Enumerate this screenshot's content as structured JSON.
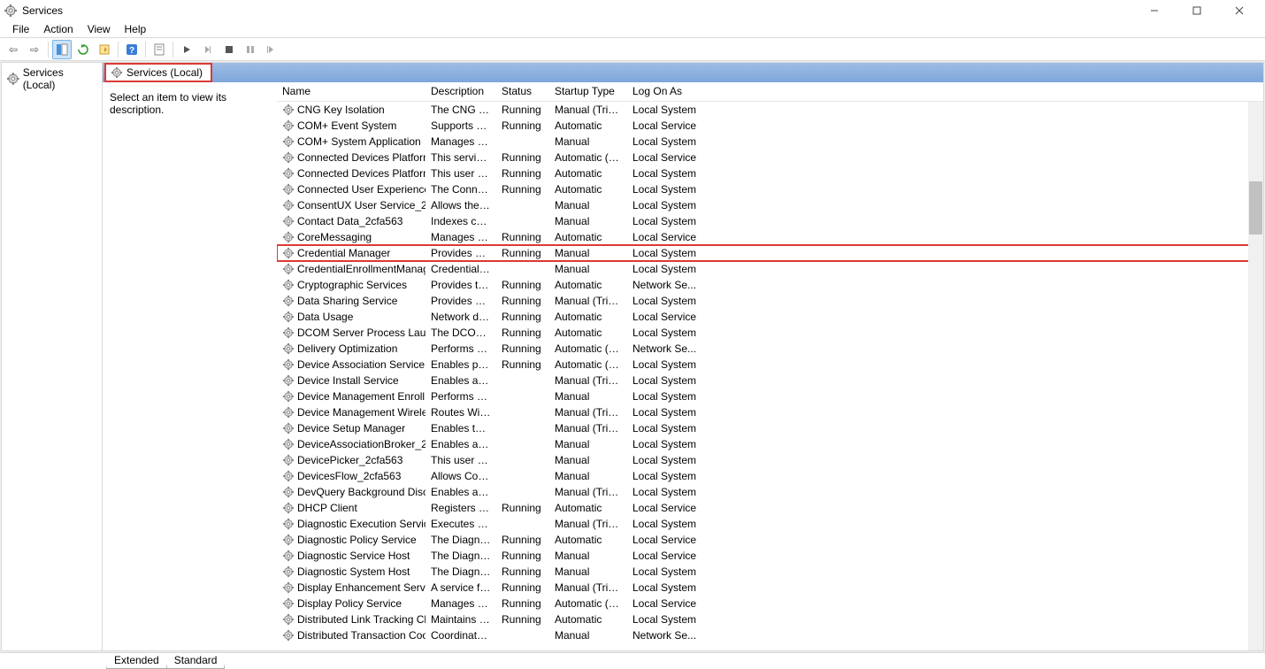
{
  "title": "Services",
  "menus": [
    "File",
    "Action",
    "View",
    "Help"
  ],
  "tree_label": "Services (Local)",
  "tab_label": "Services (Local)",
  "detail_hint": "Select an item to view its description.",
  "columns": [
    "Name",
    "Description",
    "Status",
    "Startup Type",
    "Log On As"
  ],
  "bottom_tabs": [
    "Extended",
    "Standard"
  ],
  "highlight_index": 9,
  "services": [
    {
      "name": "CNG Key Isolation",
      "desc": "The CNG ke...",
      "status": "Running",
      "start": "Manual (Trigg...",
      "logon": "Local System"
    },
    {
      "name": "COM+ Event System",
      "desc": "Supports Sy...",
      "status": "Running",
      "start": "Automatic",
      "logon": "Local Service"
    },
    {
      "name": "COM+ System Application",
      "desc": "Manages th...",
      "status": "",
      "start": "Manual",
      "logon": "Local System"
    },
    {
      "name": "Connected Devices Platform ...",
      "desc": "This service i...",
      "status": "Running",
      "start": "Automatic (De...",
      "logon": "Local Service"
    },
    {
      "name": "Connected Devices Platform ...",
      "desc": "This user ser...",
      "status": "Running",
      "start": "Automatic",
      "logon": "Local System"
    },
    {
      "name": "Connected User Experiences ...",
      "desc": "The Connect...",
      "status": "Running",
      "start": "Automatic",
      "logon": "Local System"
    },
    {
      "name": "ConsentUX User Service_2cf...",
      "desc": "Allows the s...",
      "status": "",
      "start": "Manual",
      "logon": "Local System"
    },
    {
      "name": "Contact Data_2cfa563",
      "desc": "Indexes cont...",
      "status": "",
      "start": "Manual",
      "logon": "Local System"
    },
    {
      "name": "CoreMessaging",
      "desc": "Manages co...",
      "status": "Running",
      "start": "Automatic",
      "logon": "Local Service"
    },
    {
      "name": "Credential Manager",
      "desc": "Provides sec...",
      "status": "Running",
      "start": "Manual",
      "logon": "Local System"
    },
    {
      "name": "CredentialEnrollmentManag...",
      "desc": "Credential E...",
      "status": "",
      "start": "Manual",
      "logon": "Local System"
    },
    {
      "name": "Cryptographic Services",
      "desc": "Provides thr...",
      "status": "Running",
      "start": "Automatic",
      "logon": "Network Se..."
    },
    {
      "name": "Data Sharing Service",
      "desc": "Provides dat...",
      "status": "Running",
      "start": "Manual (Trigg...",
      "logon": "Local System"
    },
    {
      "name": "Data Usage",
      "desc": "Network dat...",
      "status": "Running",
      "start": "Automatic",
      "logon": "Local Service"
    },
    {
      "name": "DCOM Server Process Launc...",
      "desc": "The DCOML...",
      "status": "Running",
      "start": "Automatic",
      "logon": "Local System"
    },
    {
      "name": "Delivery Optimization",
      "desc": "Performs co...",
      "status": "Running",
      "start": "Automatic (De...",
      "logon": "Network Se..."
    },
    {
      "name": "Device Association Service",
      "desc": "Enables pairi...",
      "status": "Running",
      "start": "Automatic (Tri...",
      "logon": "Local System"
    },
    {
      "name": "Device Install Service",
      "desc": "Enables a co...",
      "status": "",
      "start": "Manual (Trigg...",
      "logon": "Local System"
    },
    {
      "name": "Device Management Enroll...",
      "desc": "Performs De...",
      "status": "",
      "start": "Manual",
      "logon": "Local System"
    },
    {
      "name": "Device Management Wireles...",
      "desc": "Routes Wirel...",
      "status": "",
      "start": "Manual (Trigg...",
      "logon": "Local System"
    },
    {
      "name": "Device Setup Manager",
      "desc": "Enables the ...",
      "status": "",
      "start": "Manual (Trigg...",
      "logon": "Local System"
    },
    {
      "name": "DeviceAssociationBroker_2cf...",
      "desc": "Enables app...",
      "status": "",
      "start": "Manual",
      "logon": "Local System"
    },
    {
      "name": "DevicePicker_2cfa563",
      "desc": "This user ser...",
      "status": "",
      "start": "Manual",
      "logon": "Local System"
    },
    {
      "name": "DevicesFlow_2cfa563",
      "desc": "Allows Conn...",
      "status": "",
      "start": "Manual",
      "logon": "Local System"
    },
    {
      "name": "DevQuery Background Disc...",
      "desc": "Enables app...",
      "status": "",
      "start": "Manual (Trigg...",
      "logon": "Local System"
    },
    {
      "name": "DHCP Client",
      "desc": "Registers an...",
      "status": "Running",
      "start": "Automatic",
      "logon": "Local Service"
    },
    {
      "name": "Diagnostic Execution Service",
      "desc": "Executes dia...",
      "status": "",
      "start": "Manual (Trigg...",
      "logon": "Local System"
    },
    {
      "name": "Diagnostic Policy Service",
      "desc": "The Diagnos...",
      "status": "Running",
      "start": "Automatic",
      "logon": "Local Service"
    },
    {
      "name": "Diagnostic Service Host",
      "desc": "The Diagnos...",
      "status": "Running",
      "start": "Manual",
      "logon": "Local Service"
    },
    {
      "name": "Diagnostic System Host",
      "desc": "The Diagnos...",
      "status": "Running",
      "start": "Manual",
      "logon": "Local System"
    },
    {
      "name": "Display Enhancement Service",
      "desc": "A service for ...",
      "status": "Running",
      "start": "Manual (Trigg...",
      "logon": "Local System"
    },
    {
      "name": "Display Policy Service",
      "desc": "Manages th...",
      "status": "Running",
      "start": "Automatic (De...",
      "logon": "Local Service"
    },
    {
      "name": "Distributed Link Tracking Cli...",
      "desc": "Maintains li...",
      "status": "Running",
      "start": "Automatic",
      "logon": "Local System"
    },
    {
      "name": "Distributed Transaction Coor...",
      "desc": "Coordinates ...",
      "status": "",
      "start": "Manual",
      "logon": "Network Se..."
    }
  ]
}
